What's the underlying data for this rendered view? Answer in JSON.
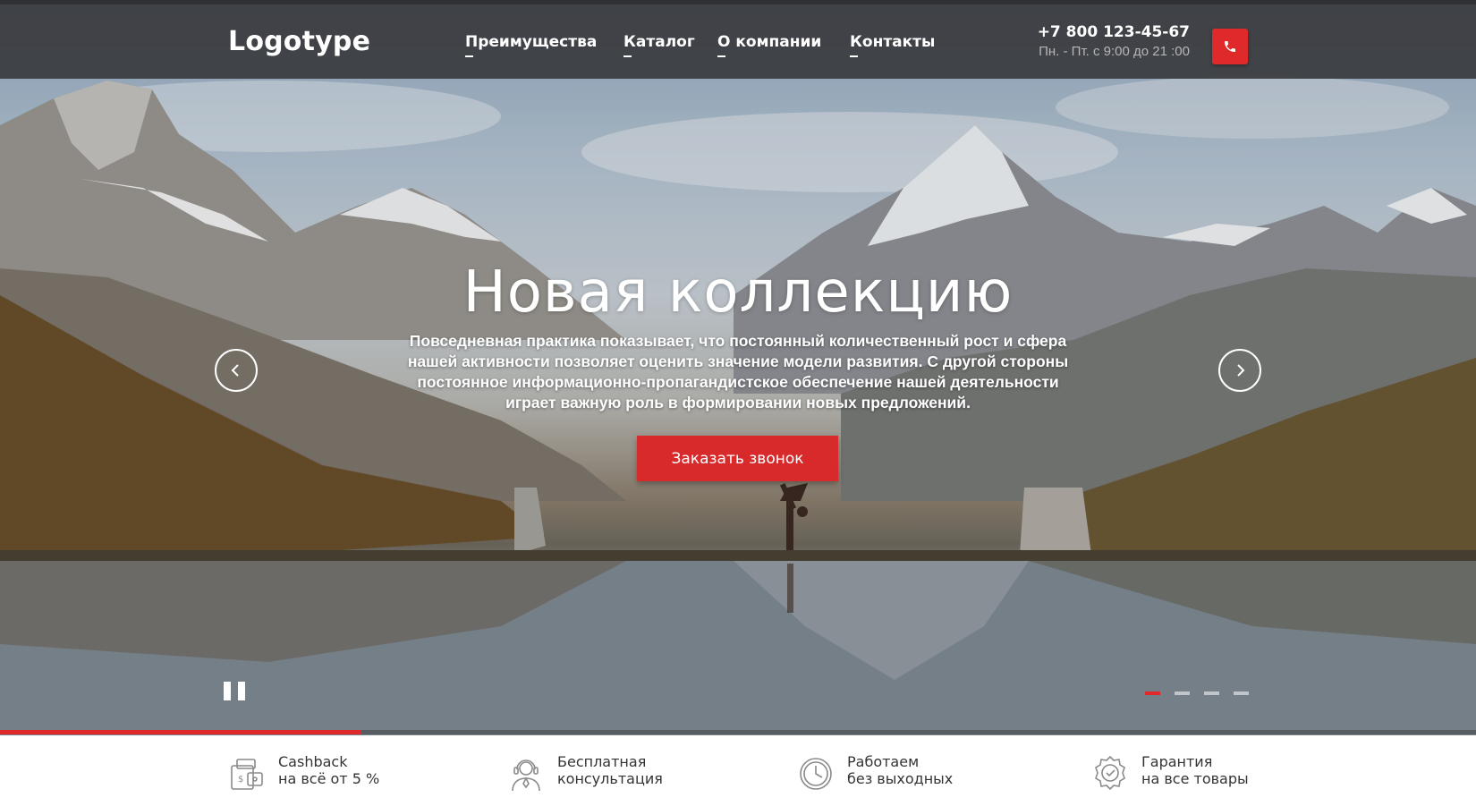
{
  "header": {
    "logo": "Logotype",
    "nav": [
      "Преимущества",
      "Каталог",
      "О компании",
      "Контакты"
    ],
    "phone": "+7 800 123-45-67",
    "hours": "Пн. - Пт. с 9:00 до 21 :00",
    "call_icon": "phone-icon"
  },
  "hero": {
    "title": "Новая коллекцию",
    "text": "Повседневная практика показывает, что постоянный количественный рост и сфера нашей активности позволяет оценить значение модели развития. С другой стороны постоянное информационно-пропагандистское обеспечение нашей деятельности играет важную роль в формировании новых предложений.",
    "button": "Заказать звонок",
    "slides_count": 4,
    "active_slide": 1,
    "progress": 0.245
  },
  "colors": {
    "accent": "#e0292b",
    "header_bg": "#3a3b3e",
    "hours": "#b6b6b8"
  },
  "features": [
    {
      "icon": "cashback-icon",
      "line1": "Cashback",
      "line2": "на всё от 5 %"
    },
    {
      "icon": "support-agent-icon",
      "line1": "Бесплатная",
      "line2": "консультация"
    },
    {
      "icon": "clock-icon",
      "line1": "Работаем",
      "line2": "без выходных"
    },
    {
      "icon": "guarantee-badge-icon",
      "line1": "Гарантия",
      "line2": "на все товары"
    }
  ]
}
